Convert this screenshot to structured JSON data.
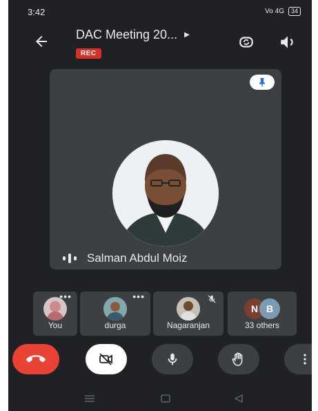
{
  "status_bar": {
    "time": "3:42",
    "signal": "Vo 4G",
    "battery": "34"
  },
  "header": {
    "title": "DAC Meeting 20...",
    "rec_label": "REC"
  },
  "main_tile": {
    "speaker_name": "Salman Abdul Moiz"
  },
  "participants": [
    {
      "label": "You"
    },
    {
      "label": "durga"
    },
    {
      "label": "Nagaranjan"
    },
    {
      "label": "33 others",
      "initials": [
        "N",
        "B"
      ]
    }
  ],
  "colors": {
    "background": "#202124",
    "tile": "#3c4043",
    "end_call": "#ea4335",
    "rec": "#d93025"
  },
  "icons": [
    "back-arrow-icon",
    "switch-camera-icon",
    "speaker-icon",
    "pin-icon",
    "audio-level-icon",
    "mic-off-icon",
    "end-call-icon",
    "camera-off-icon",
    "mic-icon",
    "raise-hand-icon",
    "more-options-icon"
  ]
}
